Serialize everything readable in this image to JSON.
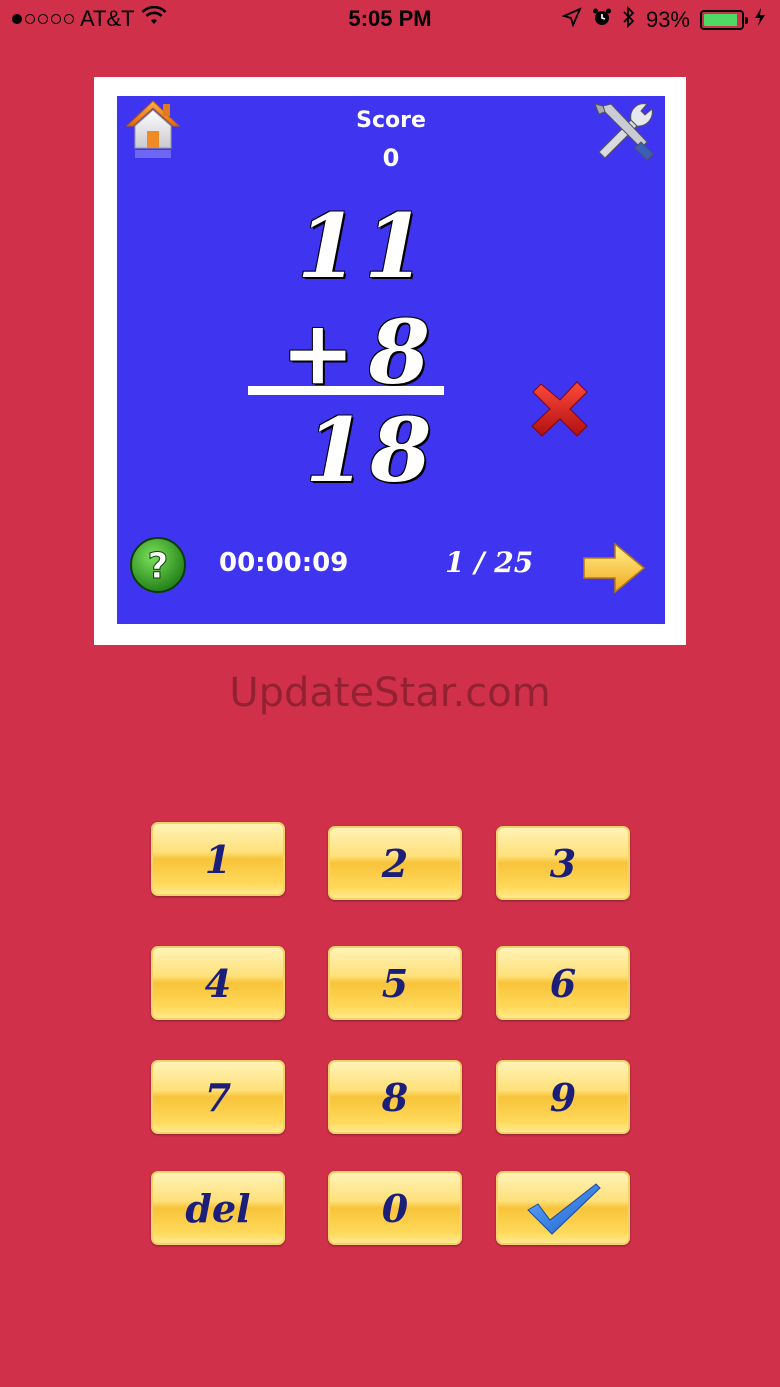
{
  "status_bar": {
    "carrier": "AT&T",
    "time": "5:05 PM",
    "battery": "93%",
    "battery_level": 0.93,
    "signal_bars_filled": 1,
    "signal_bars_total": 5
  },
  "game": {
    "score_label": "Score",
    "score_value": "0",
    "top_number": "11",
    "operator": "+",
    "second_number": "8",
    "entered_answer": "18",
    "timer": "00:00:09",
    "progress": "1 / 25",
    "answer_status": "wrong"
  },
  "watermark": "UpdateStar.com",
  "keypad": {
    "k1": "1",
    "k2": "2",
    "k3": "3",
    "k4": "4",
    "k5": "5",
    "k6": "6",
    "k7": "7",
    "k8": "8",
    "k9": "9",
    "del": "del",
    "k0": "0"
  },
  "colors": {
    "background": "#d0304a",
    "board": "#3f35f0",
    "key_text": "#1c1f7a"
  }
}
